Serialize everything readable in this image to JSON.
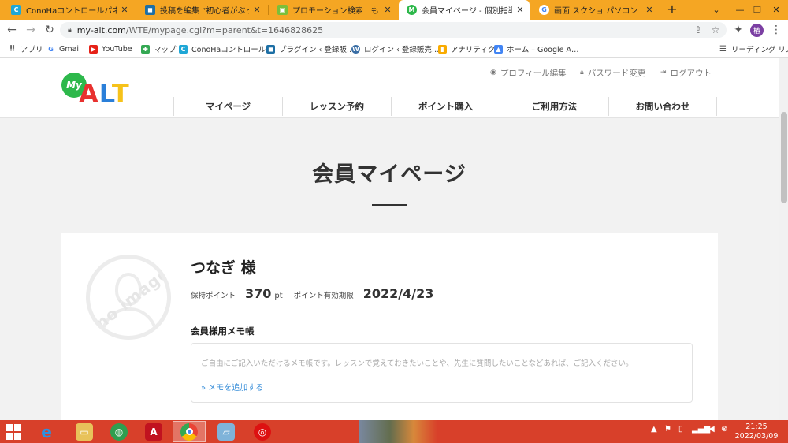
{
  "browser": {
    "tabs": [
      {
        "title": "ConoHaコントロールパネル",
        "close": "✕"
      },
      {
        "title": "投稿を編集 “初心者がぶっつけ本",
        "close": "✕"
      },
      {
        "title": "プロモーション検索　もしもアフィ",
        "close": "✕"
      },
      {
        "title": "会員マイページ - 個別指導オンラ",
        "close": "✕"
      },
      {
        "title": "画面 スクショ パソコン - Google",
        "close": "✕"
      }
    ],
    "new_tab": "+",
    "url_host": "my-alt.com",
    "url_path": "/WTE/mypage.cgi?m=parent&t=1646828625",
    "profile_initial": "椿",
    "bookmarks": [
      "アプリ",
      "Gmail",
      "YouTube",
      "マップ",
      "ConoHaコントロール…",
      "プラグイン ‹ 登録販…",
      "ログイン ‹ 登録販売…",
      "アナリティクス",
      "ホーム – Google A…",
      "リーディング リスト"
    ]
  },
  "site": {
    "logo_my": "My",
    "logo_a": "A",
    "logo_l": "L",
    "logo_t": "T",
    "top_links": [
      "プロフィール編集",
      "パスワード変更",
      "ログアウト"
    ],
    "nav": [
      "マイページ",
      "レッスン予約",
      "ポイント購入",
      "ご利用方法",
      "お問い合わせ"
    ],
    "page_title": "会員マイページ"
  },
  "member": {
    "avatar_text": "no image",
    "name": "つなぎ 様",
    "points_label": "保持ポイント",
    "points_value": "370",
    "points_unit": "pt",
    "expiry_label": "ポイント有効期限",
    "expiry_value": "2022/4/23",
    "memo_heading": "会員様用メモ帳",
    "memo_placeholder": "ご自由にご記入いただけるメモ帳です。レッスンで覚えておきたいことや、先生に質問したいことなどあれば、ご記入ください。",
    "memo_add": "» メモを追加する"
  },
  "taskbar": {
    "time": "21:25",
    "date": "2022/03/09"
  },
  "colors": {
    "tabstrip": "#f5a623",
    "taskbar": "#d8402a",
    "link": "#3a8fd9"
  }
}
